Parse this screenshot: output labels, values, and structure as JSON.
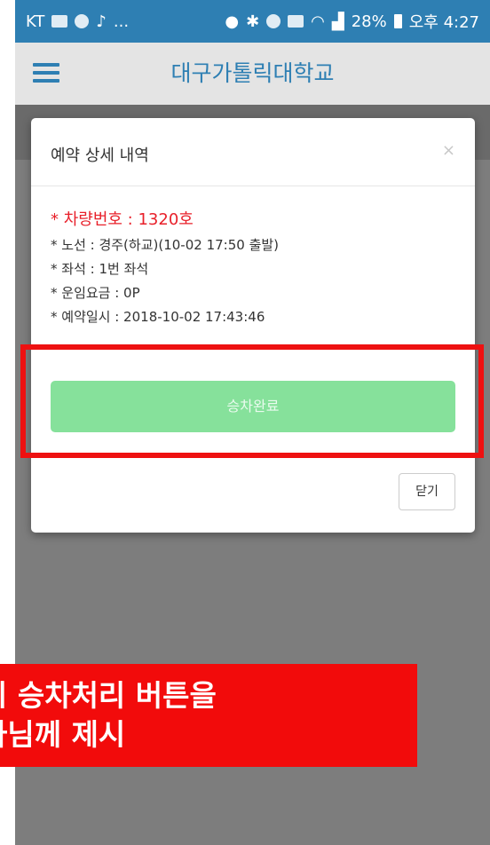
{
  "status_bar": {
    "carrier": "KT",
    "more": "...",
    "battery_percent": "28%",
    "time": "오후 4:27"
  },
  "app_bar": {
    "title": "대구가톨릭대학교"
  },
  "modal": {
    "title": "예약 상세 내역",
    "close_glyph": "×",
    "vehicle_line": "* 차량번호 : 1320호",
    "details": [
      "* 노선 : 경주(하교)(10-02 17:50 출발)",
      "* 좌석 : 1번 좌석",
      "* 운임요금 : 0P",
      "* 예약일시 : 2018-10-02 17:43:46"
    ],
    "board_button": "승차완료",
    "close_button": "닫기"
  },
  "annotation": {
    "line1": "시 승차처리 버튼을",
    "line2": "사님께 제시"
  },
  "colors": {
    "status_bar": "#2e7fb3",
    "app_bar": "#e4e4e4",
    "accent": "#2e7fb3",
    "vehicle_text": "#e8202a",
    "board_button": "#86e19b",
    "highlight": "#ee1111",
    "overlay": "#7d7d7d"
  }
}
